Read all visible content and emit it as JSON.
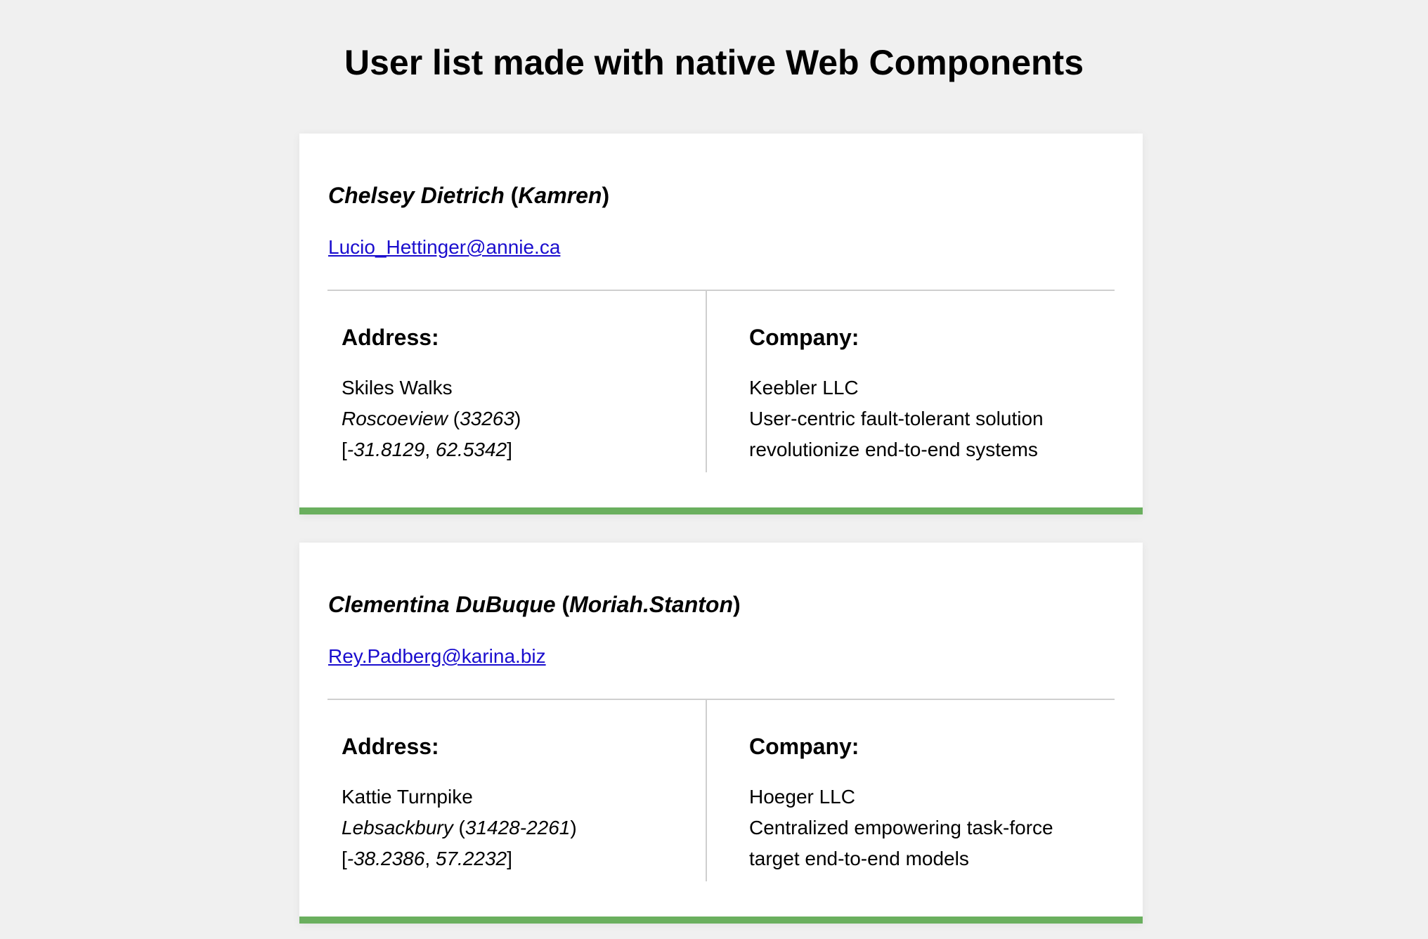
{
  "page": {
    "title": "User list made with native Web Components"
  },
  "labels": {
    "address": "Address:",
    "company": "Company:"
  },
  "colors": {
    "background": "#f0f0f0",
    "card": "#ffffff",
    "accent": "#6aaf5e",
    "link": "#1a0dce"
  },
  "users": [
    {
      "name": "Chelsey Dietrich",
      "username": "Kamren",
      "email": "Lucio_Hettinger@annie.ca",
      "address": {
        "street": "Skiles Walks",
        "city": "Roscoeview",
        "zipcode": "33263",
        "lat": "-31.8129",
        "lng": "62.5342"
      },
      "company": {
        "name": "Keebler LLC",
        "catchPhrase": "User-centric fault-tolerant solution",
        "bs": "revolutionize end-to-end systems"
      }
    },
    {
      "name": "Clementina DuBuque",
      "username": "Moriah.Stanton",
      "email": "Rey.Padberg@karina.biz",
      "address": {
        "street": "Kattie Turnpike",
        "city": "Lebsackbury",
        "zipcode": "31428-2261",
        "lat": "-38.2386",
        "lng": "57.2232"
      },
      "company": {
        "name": "Hoeger LLC",
        "catchPhrase": "Centralized empowering task-force",
        "bs": "target end-to-end models"
      }
    }
  ]
}
